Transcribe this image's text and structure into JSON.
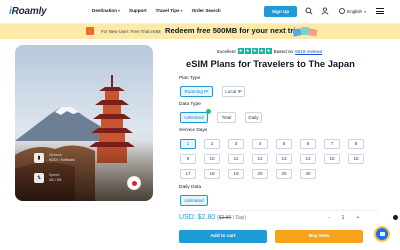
{
  "header": {
    "logo_prefix": "i",
    "logo_rest": "Roamly",
    "nav": [
      {
        "label": "Destination",
        "has_dropdown": true
      },
      {
        "label": "Support",
        "has_dropdown": false
      },
      {
        "label": "Travel Tips",
        "has_dropdown": true
      },
      {
        "label": "Order Search",
        "has_dropdown": false
      }
    ],
    "signup_label": "Sign Up",
    "language": "English"
  },
  "promo": {
    "sub": "For New User: Free Trial eSIM",
    "main": "Redeem free 500MB for your next trip >>"
  },
  "hero": {
    "network_label": "Network",
    "network_value": "KDDI / Softbank",
    "speed_label": "Speed",
    "speed_value": "4G / 5G"
  },
  "rating": {
    "label": "Excellent",
    "based_on": "Based on",
    "reviews": "6019 reviews"
  },
  "title": "eSIM Plans for Travelers to The Japan",
  "plan_type": {
    "label": "Plan Type",
    "options": [
      "Roaming IP",
      "Local IP"
    ],
    "selected": "Roaming IP"
  },
  "data_type": {
    "label": "Data Type",
    "options": [
      "Unlimited",
      "Total",
      "Daily"
    ],
    "selected": "Unlimited"
  },
  "service_days": {
    "label": "Service Days",
    "options": [
      "1",
      "2",
      "3",
      "4",
      "5",
      "6",
      "7",
      "8",
      "9",
      "10",
      "11",
      "12",
      "13",
      "14",
      "15",
      "16",
      "17",
      "18",
      "19",
      "20",
      "25",
      "30"
    ],
    "selected": "1"
  },
  "daily_data": {
    "label": "Daily Data",
    "options": [
      "Unlimited"
    ],
    "selected": "Unlimited"
  },
  "price": {
    "current": "USD: $2.80",
    "old_prefix": "(",
    "old": "$2.80",
    "old_suffix": " / Day)"
  },
  "quantity": {
    "minus": "-",
    "value": "1",
    "plus": "+"
  },
  "actions": {
    "add_to_cart": "Add to cart",
    "buy_now": "Buy Now"
  },
  "colors": {
    "primary": "#1d9bd7",
    "accent": "#f6a31b",
    "rating": "#15b79e"
  }
}
